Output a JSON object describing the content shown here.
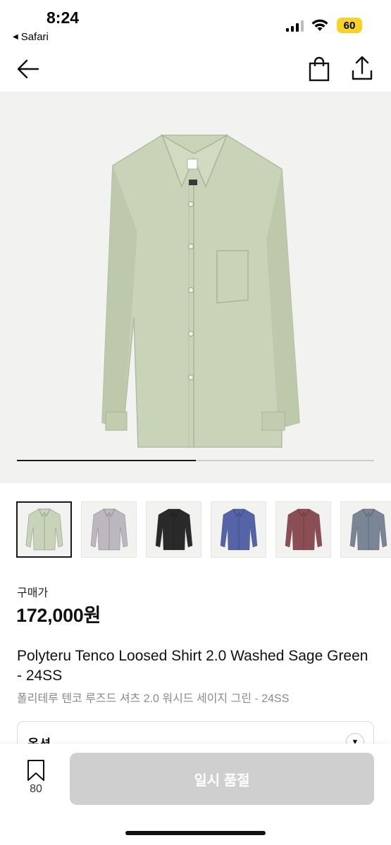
{
  "status_bar": {
    "time": "8:24",
    "back_app": "Safari",
    "battery": "60",
    "battery_color": "#f7d227"
  },
  "nav": {
    "back_icon": "arrow-left-icon",
    "bag_icon": "shopping-bag-icon",
    "share_icon": "share-icon"
  },
  "gallery": {
    "progress": 0.5,
    "main_color": "#c9d3b8",
    "thumbnails": [
      {
        "color": "#c9d3b8",
        "selected": true
      },
      {
        "color": "#bdb8bf",
        "selected": false
      },
      {
        "color": "#2a2a2a",
        "selected": false
      },
      {
        "color": "#5563a8",
        "selected": false
      },
      {
        "color": "#8a4e54",
        "selected": false
      },
      {
        "color": "#7a8595",
        "selected": false
      }
    ]
  },
  "product": {
    "price_label": "구매가",
    "price": "172,000원",
    "title_en": "Polyteru Tenco Loosed Shirt 2.0 Washed Sage Green - 24SS",
    "title_ko": "폴리테루 텐코 루즈드 셔츠 2.0 워시드 세이지 그린 - 24SS"
  },
  "option": {
    "label": "옵션"
  },
  "bottom_bar": {
    "wishlist_count": "80",
    "soldout_label": "일시 품절"
  }
}
